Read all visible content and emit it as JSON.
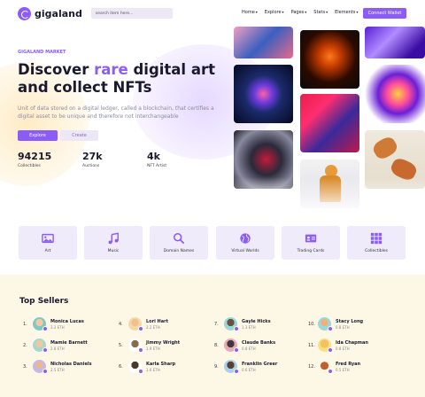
{
  "header": {
    "logo": "gigaland",
    "search_placeholder": "search item here...",
    "nav": [
      "Home",
      "Explore",
      "Pages",
      "Stats",
      "Elements"
    ],
    "connect": "Connect Wallet"
  },
  "hero": {
    "eyebrow": "GIGALAND MARKET",
    "title_1": "Discover ",
    "title_accent": "rare",
    "title_2": " digital art",
    "title_3": "and collect NFTs",
    "description": "Unit of data stored on a digital ledger, called a blockchain, that certifies a digital asset to be unique and therefore not interchangeable",
    "explore_label": "Explore",
    "create_label": "Create",
    "stats": [
      {
        "value": "94215",
        "label": "Collectibles"
      },
      {
        "value": "27k",
        "label": "Auctions"
      },
      {
        "value": "4k",
        "label": "NFT Artist"
      }
    ]
  },
  "categories": [
    {
      "label": "Art",
      "icon": "image-icon"
    },
    {
      "label": "Music",
      "icon": "music-icon"
    },
    {
      "label": "Domain Names",
      "icon": "search-icon"
    },
    {
      "label": "Virtual Worlds",
      "icon": "globe-icon"
    },
    {
      "label": "Trading Cards",
      "icon": "id-card-icon"
    },
    {
      "label": "Collectibles",
      "icon": "grid-icon"
    }
  ],
  "top_sellers": {
    "title": "Top Sellers",
    "sellers": [
      {
        "rank": "1.",
        "name": "Monica Lucas",
        "eth": "3.2 ETH"
      },
      {
        "rank": "2.",
        "name": "Mamie Barnett",
        "eth": "2.8 ETH"
      },
      {
        "rank": "3.",
        "name": "Nicholas Daniels",
        "eth": "2.5 ETH"
      },
      {
        "rank": "4.",
        "name": "Lori Hart",
        "eth": "2.2 ETH"
      },
      {
        "rank": "5.",
        "name": "Jimmy Wright",
        "eth": "1.9 ETH"
      },
      {
        "rank": "6.",
        "name": "Karla Sharp",
        "eth": "1.6 ETH"
      },
      {
        "rank": "7.",
        "name": "Gayle Hicks",
        "eth": "1.3 ETH"
      },
      {
        "rank": "8.",
        "name": "Claude Banks",
        "eth": "0.8 ETH"
      },
      {
        "rank": "9.",
        "name": "Franklin Greer",
        "eth": "0.6 ETH"
      },
      {
        "rank": "10.",
        "name": "Stacy Long",
        "eth": "0.8 ETH"
      },
      {
        "rank": "11.",
        "name": "Ida Chapman",
        "eth": "0.8 ETH"
      },
      {
        "rank": "12.",
        "name": "Fred Ryan",
        "eth": "0.5 ETH"
      }
    ]
  },
  "colors": {
    "accent": "#8b5cf6",
    "accent_light": "#efebfb",
    "sellers_bg": "#fdf7e6"
  }
}
